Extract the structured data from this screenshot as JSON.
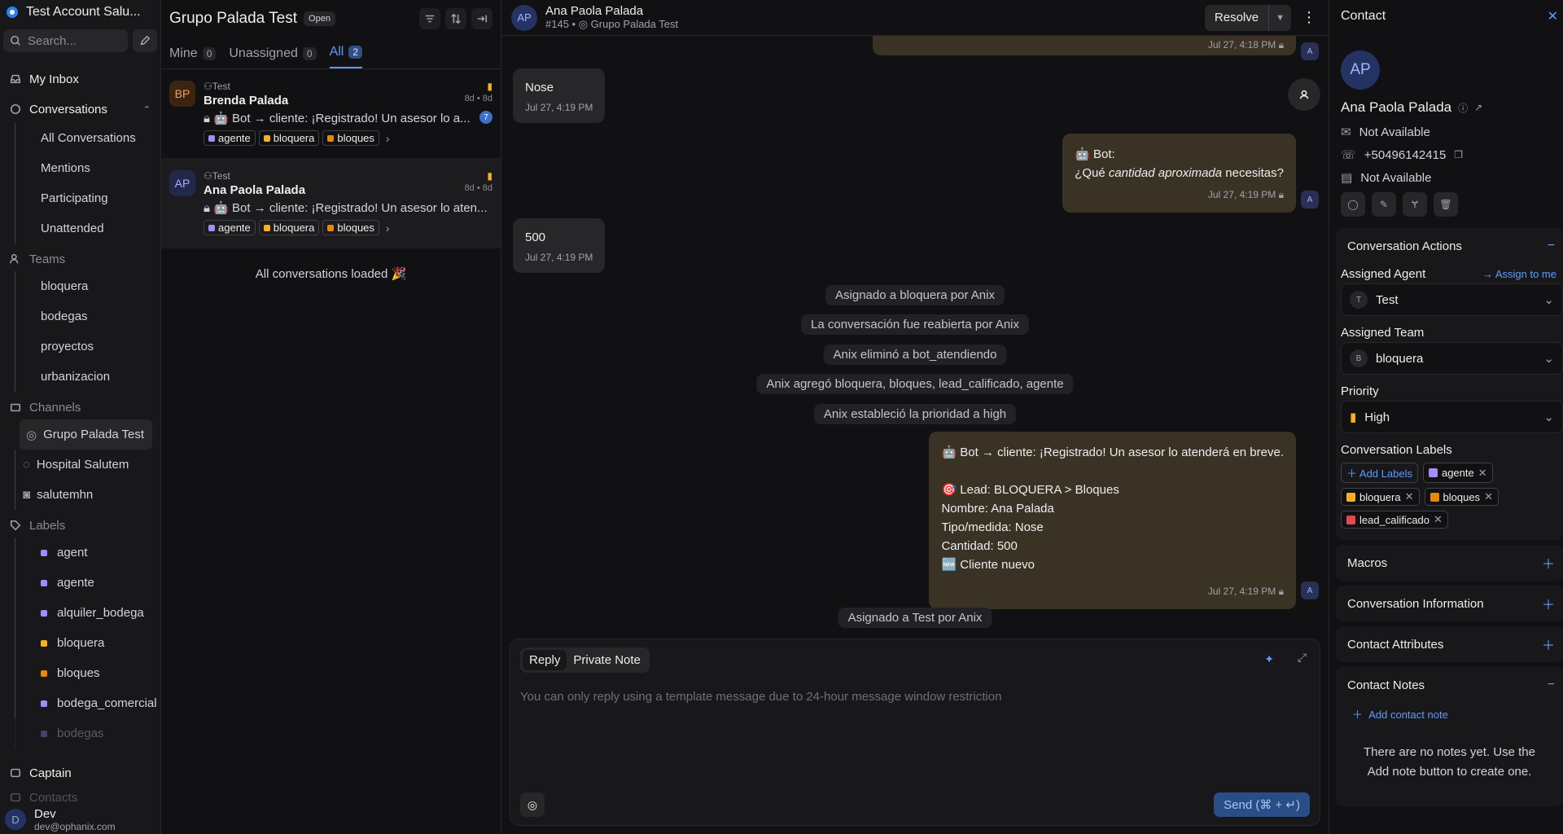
{
  "sidebar": {
    "account_name": "Test Account Salu...",
    "search_placeholder": "Search...",
    "my_inbox": "My Inbox",
    "conversations": "Conversations",
    "conv_items": [
      "All Conversations",
      "Mentions",
      "Participating",
      "Unattended"
    ],
    "teams": "Teams",
    "team_items": [
      "bloquera",
      "bodegas",
      "proyectos",
      "urbanizacion"
    ],
    "channels": "Channels",
    "channel_items": [
      "Grupo Palada Test",
      "Hospital Salutem",
      "salutemhn"
    ],
    "labels": "Labels",
    "label_items": [
      {
        "name": "agent",
        "color": "#a78bfa"
      },
      {
        "name": "agente",
        "color": "#a78bfa"
      },
      {
        "name": "alquiler_bodega",
        "color": "#a78bfa"
      },
      {
        "name": "bloquera",
        "color": "#f5b025"
      },
      {
        "name": "bloques",
        "color": "#e8860e"
      },
      {
        "name": "bodega_comercial",
        "color": "#a78bfa"
      },
      {
        "name": "bodegas",
        "color": "#a78bfa"
      }
    ],
    "captain": "Captain",
    "contacts": "Contacts",
    "user_name": "Dev",
    "user_initial": "D",
    "user_email": "dev@ophanix.com"
  },
  "list": {
    "title": "Grupo Palada Test",
    "status": "Open",
    "tabs": [
      {
        "label": "Mine",
        "count": "0"
      },
      {
        "label": "Unassigned",
        "count": "0"
      },
      {
        "label": "All",
        "count": "2"
      }
    ],
    "conversations": [
      {
        "initials": "BP",
        "inbox": "Test",
        "name": "Brenda Palada",
        "meta": "8d • 8d",
        "preview": "🤖 Bot → cliente: ¡Registrado! Un asesor lo a...",
        "unread": "7",
        "tags": [
          "agente",
          "bloquera",
          "bloques"
        ]
      },
      {
        "initials": "AP",
        "inbox": "Test",
        "name": "Ana Paola Palada",
        "meta": "8d • 8d",
        "preview": "🤖 Bot → cliente: ¡Registrado! Un asesor lo aten...",
        "unread": "",
        "tags": [
          "agente",
          "bloquera",
          "bloques"
        ]
      }
    ],
    "tag_colors": {
      "agente": "#a78bfa",
      "bloquera": "#f5b025",
      "bloques": "#e8860e",
      "lead_calificado": "#e5484d"
    },
    "all_loaded": "All conversations loaded 🎉"
  },
  "chat": {
    "initials": "AP",
    "name": "Ana Paola Palada",
    "conv_id": "#145",
    "inbox": "Grupo Palada Test",
    "resolve": "Resolve",
    "top_time": "Jul 27, 4:18 PM",
    "msg1_text": "Nose",
    "msg1_time": "Jul 27, 4:19 PM",
    "bot_q_line1": "🤖 Bot:",
    "bot_q_pre": "¿Qué ",
    "bot_q_em": "cantidad aproximada",
    "bot_q_post": " necesitas?",
    "bot_q_time": "Jul 27, 4:19 PM",
    "msg2_text": "500",
    "msg2_time": "Jul 27, 4:19 PM",
    "activities": [
      "Asignado a bloquera por Anix",
      "La conversación fue reabierta por Anix",
      "Anix eliminó a bot_atendiendo",
      "Anix agregó bloquera, bloques, lead_calificado, agente",
      "Anix estableció la prioridad a high"
    ],
    "final_lines": [
      "🤖 Bot → cliente: ¡Registrado! Un asesor lo atenderá en breve.",
      "",
      "🎯 Lead: BLOQUERA > Bloques",
      "Nombre: Ana Palada",
      "Tipo/medida: Nose",
      "Cantidad: 500",
      "🆕 Cliente nuevo"
    ],
    "final_time": "Jul 27, 4:19 PM",
    "last_activity": "Asignado a Test por Anix",
    "agent_initial": "A",
    "reply_tab": "Reply",
    "note_tab": "Private Note",
    "composer_placeholder": "You can only reply using a template message due to 24-hour message window restriction",
    "send": "Send (⌘ + ↵)"
  },
  "contact": {
    "title": "Contact",
    "initials": "AP",
    "name": "Ana Paola Palada",
    "email": "Not Available",
    "phone": "+50496142415",
    "company": "Not Available",
    "conv_actions": "Conversation Actions",
    "assigned_agent_label": "Assigned Agent",
    "assign_to_me": "Assign to me",
    "agent": "Test",
    "agent_initial": "T",
    "assigned_team_label": "Assigned Team",
    "team": "bloquera",
    "team_initial": "B",
    "priority_label": "Priority",
    "priority": "High",
    "labels_label": "Conversation Labels",
    "add_labels": "Add Labels",
    "labels": [
      "agente",
      "bloquera",
      "bloques",
      "lead_calificado"
    ],
    "macros": "Macros",
    "conv_info": "Conversation Information",
    "contact_attrs": "Contact Attributes",
    "contact_notes": "Contact Notes",
    "add_note": "Add contact note",
    "no_notes": "There are no notes yet. Use the Add note button to create one."
  }
}
